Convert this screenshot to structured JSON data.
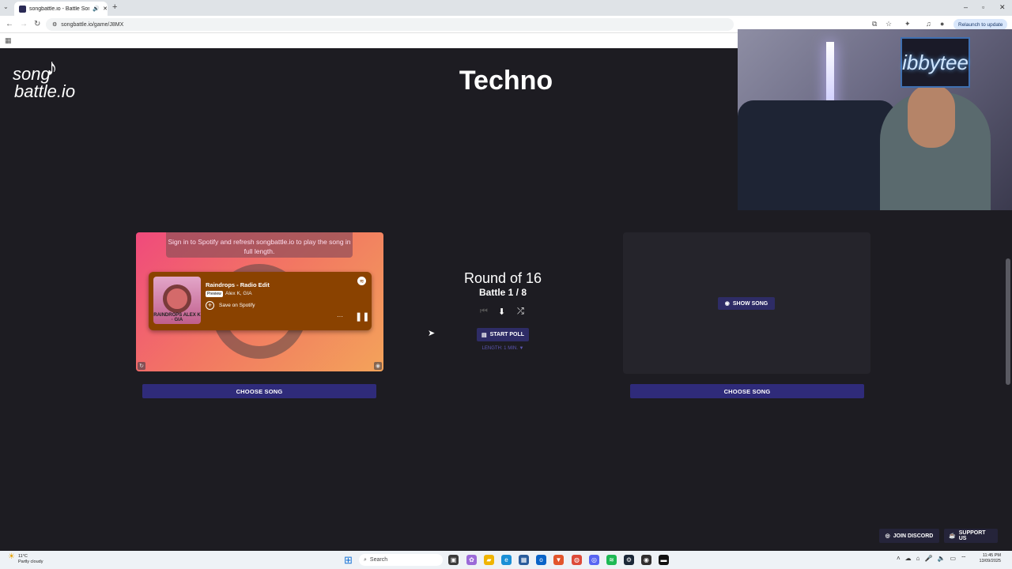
{
  "browser": {
    "tab_title": "songbattle.io - Battle Song...",
    "url": "songbattle.io/game/J8MX",
    "relaunch_label": "Relaunch to update"
  },
  "logo": {
    "line1": "song",
    "line2": "battle.io"
  },
  "page_title": "Techno",
  "webcam": {
    "neon_sign": "ibbytee"
  },
  "left_card": {
    "signin_message": "Sign in to Spotify and refresh songbattle.io to play the song in full length.",
    "track_title": "Raindrops - Radio Edit",
    "preview_badge": "Preview",
    "artist": "Alex K, GIA",
    "save_label": "Save on Spotify",
    "album_text": "RAINDROPS\nALEX K · GIA",
    "more_label": "···"
  },
  "right_card": {
    "show_song_label": "SHOW SONG"
  },
  "choose_song_label": "CHOOSE SONG",
  "center": {
    "round": "Round of 16",
    "battle": "Battle 1 / 8",
    "start_poll": "START POLL",
    "length": "LENGTH: 1 MIN. ▼"
  },
  "footer_buttons": {
    "discord": "JOIN DISCORD",
    "support": "SUPPORT US"
  },
  "taskbar": {
    "weather_temp": "11°C",
    "weather_desc": "Partly cloudy",
    "search_placeholder": "Search",
    "time": "11:45 PM",
    "date": "13/09/2025"
  }
}
